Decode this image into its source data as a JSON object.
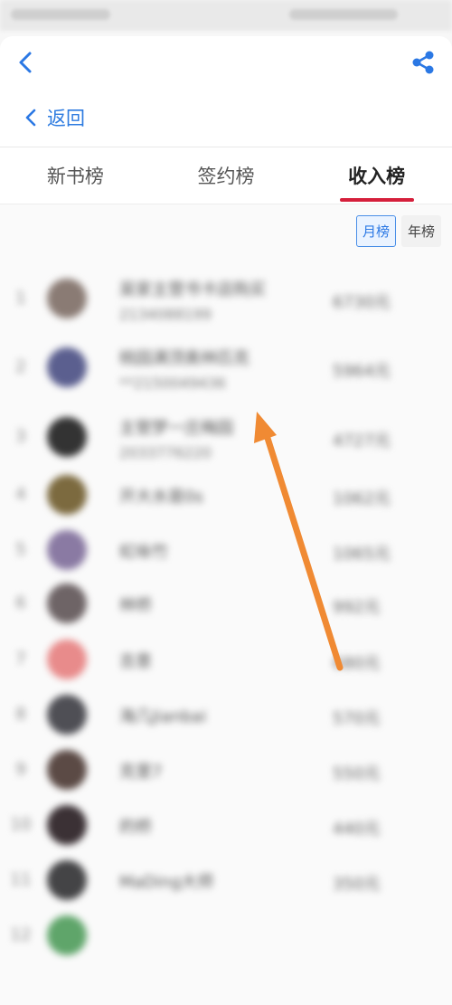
{
  "topbar": {
    "back_icon": "chevron-left-icon",
    "share_icon": "share-icon"
  },
  "subnav": {
    "back_label": "返回"
  },
  "tabs": [
    {
      "label": "新书榜",
      "active": false
    },
    {
      "label": "签约榜",
      "active": false
    },
    {
      "label": "收入榜",
      "active": true
    }
  ],
  "period": {
    "monthly": "月榜",
    "yearly": "年榜",
    "selected": "月榜"
  },
  "ranking": [
    {
      "rank": "1",
      "name": "吴家主营书卡店购买",
      "sub": "2134088199",
      "amount": "6730元",
      "avatar_color": "#8a7b74"
    },
    {
      "rank": "2",
      "name": "桃园满顶奥林匹克",
      "sub": "**2150049436",
      "amount": "5964元",
      "avatar_color": "#5b5f8f"
    },
    {
      "rank": "3",
      "name": "主管梦一庄梅园",
      "sub": "2033776220",
      "amount": "4727元",
      "avatar_color": "#333333"
    },
    {
      "rank": "4",
      "name": "开大水是0s",
      "sub": "",
      "amount": "1062元",
      "avatar_color": "#7c6a3f"
    },
    {
      "rank": "5",
      "name": "虹咏竹",
      "sub": "",
      "amount": "1065元",
      "avatar_color": "#8a7aa3"
    },
    {
      "rank": "6",
      "name": "林桥",
      "sub": "",
      "amount": "992元",
      "avatar_color": "#6e6466"
    },
    {
      "rank": "7",
      "name": "吉意",
      "sub": "",
      "amount": "680元",
      "avatar_color": "#e88b8b"
    },
    {
      "rank": "8",
      "name": "海几Jianbai",
      "sub": "",
      "amount": "570元",
      "avatar_color": "#4f4f55"
    },
    {
      "rank": "9",
      "name": "克里7",
      "sub": "",
      "amount": "550元",
      "avatar_color": "#5b4a45"
    },
    {
      "rank": "10",
      "name": "的桥",
      "sub": "",
      "amount": "440元",
      "avatar_color": "#3b3135"
    },
    {
      "rank": "11",
      "name": "MaDing大师",
      "sub": "",
      "amount": "350元",
      "avatar_color": "#444446"
    },
    {
      "rank": "12",
      "name": "",
      "sub": "",
      "amount": "",
      "avatar_color": "#5fa56a"
    }
  ],
  "annotation": {
    "arrow_color": "#f08a33"
  },
  "colors": {
    "accent": "#2b78e4",
    "tab_indicator": "#d51f3b"
  }
}
